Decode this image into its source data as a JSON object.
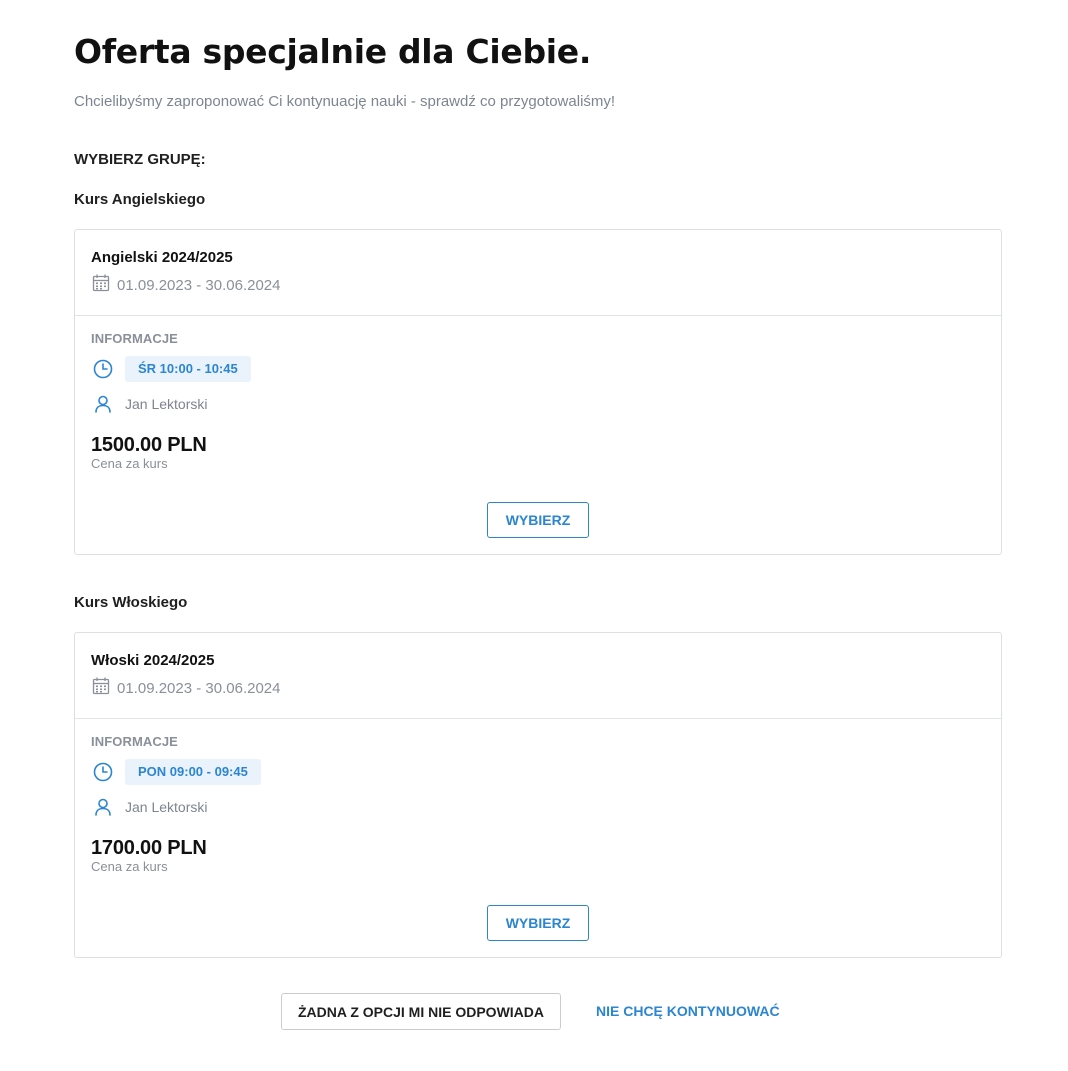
{
  "header": {
    "title": "Oferta specjalnie dla Ciebie.",
    "subtitle": "Chcielibyśmy zaproponować Ci kontynuację nauki - sprawdź co przygotowaliśmy!",
    "choose_group_label": "WYBIERZ GRUPĘ:"
  },
  "groups": [
    {
      "group_title": "Kurs Angielskiego",
      "name": "Angielski 2024/2025",
      "dates": "01.09.2023 - 30.06.2024",
      "info_label": "INFORMACJE",
      "time": "ŚR 10:00 - 10:45",
      "teacher": "Jan Lektorski",
      "price": "1500.00 PLN",
      "price_note": "Cena za kurs",
      "button_label": "WYBIERZ"
    },
    {
      "group_title": "Kurs Włoskiego",
      "name": "Włoski 2024/2025",
      "dates": "01.09.2023 - 30.06.2024",
      "info_label": "INFORMACJE",
      "time": "PON 09:00 - 09:45",
      "teacher": "Jan Lektorski",
      "price": "1700.00 PLN",
      "price_note": "Cena za kurs",
      "button_label": "WYBIERZ"
    }
  ],
  "actions": {
    "none_fits_label": "ŻADNA Z OPCJI MI NIE ODPOWIADA",
    "dont_continue_label": "NIE CHCĘ KONTYNUOWAĆ"
  },
  "colors": {
    "accent": "#2b85d0",
    "badge_bg": "#eaf3fb",
    "muted_text": "#8a9099",
    "border": "#dcdfe3"
  },
  "icons": {
    "date": "calendar-icon",
    "time": "clock-icon",
    "teacher": "user-icon"
  }
}
